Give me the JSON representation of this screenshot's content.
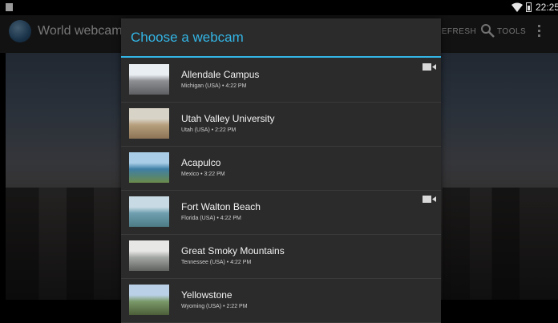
{
  "status_bar": {
    "time": "22:25"
  },
  "action_bar": {
    "title": "World webcams",
    "refresh_label": "REFRESH",
    "tools_label": "TOOLS"
  },
  "dialog": {
    "title": "Choose a webcam",
    "items": [
      {
        "name": "Allendale Campus",
        "location": "Michigan (USA)",
        "time": "4:22 PM",
        "video": true,
        "thumb_colors": [
          "#e9eef2",
          "#8d8f93",
          "#5e5f62"
        ]
      },
      {
        "name": "Utah Valley University",
        "location": "Utah (USA)",
        "time": "2:22 PM",
        "video": false,
        "thumb_colors": [
          "#d8d3c7",
          "#b69f7c",
          "#8b7355"
        ]
      },
      {
        "name": "Acapulco",
        "location": "Mexico",
        "time": "3:22 PM",
        "video": false,
        "thumb_colors": [
          "#a9cde6",
          "#3f7fa6",
          "#6b8a4a"
        ]
      },
      {
        "name": "Fort Walton Beach",
        "location": "Florida (USA)",
        "time": "4:22 PM",
        "video": true,
        "thumb_colors": [
          "#c8dbe4",
          "#6f9fb0",
          "#4d7c86"
        ]
      },
      {
        "name": "Great Smoky Mountains",
        "location": "Tennessee (USA)",
        "time": "4:22 PM",
        "video": false,
        "thumb_colors": [
          "#e7e7e5",
          "#a5a8a5",
          "#5f625e"
        ]
      },
      {
        "name": "Yellowstone",
        "location": "Wyoming (USA)",
        "time": "2:22 PM",
        "video": false,
        "thumb_colors": [
          "#b9d0e6",
          "#7b9a6b",
          "#4c5e38"
        ]
      }
    ]
  }
}
